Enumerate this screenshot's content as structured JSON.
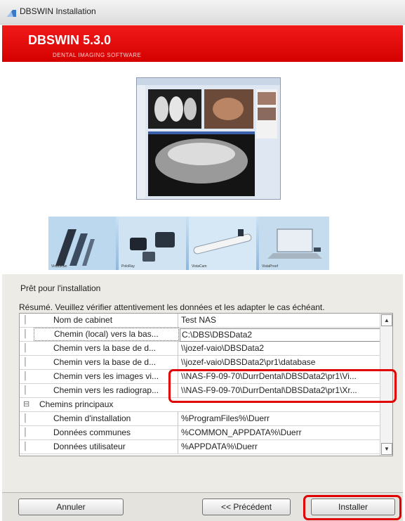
{
  "window": {
    "title": "DBSWIN Installation",
    "product": "DBSWIN 5.3.0",
    "subtitle": "DENTAL IMAGING SOFTWARE"
  },
  "products": [
    {
      "caption": "VistaScan"
    },
    {
      "caption": "PoloRay"
    },
    {
      "caption": "VistaCam"
    },
    {
      "caption": "VistaProof"
    }
  ],
  "ready_label": "Prêt pour l'installation",
  "summary_label": "Résumé. Veuillez vérifier attentivement les données et les adapter le cas échéant.",
  "rows": [
    {
      "label": "Nom de cabinet",
      "value": "Test NAS"
    },
    {
      "label": "Chemin (local) vers la bas...",
      "value": "C:\\DBS\\DBSData2"
    },
    {
      "label": "Chemin vers la base de d...",
      "value": "\\\\jozef-vaio\\DBSData2"
    },
    {
      "label": "Chemin vers la base de d...",
      "value": "\\\\jozef-vaio\\DBSData2\\pr1\\database"
    },
    {
      "label": "Chemin vers les images vi...",
      "value": "\\\\NAS-F9-09-70\\DurrDental\\DBSData2\\pr1\\Vi..."
    },
    {
      "label": "Chemin vers les radiograp...",
      "value": "\\\\NAS-F9-09-70\\DurrDental\\DBSData2\\pr1\\Xr..."
    },
    {
      "label": "Chemins principaux",
      "value": "",
      "expander": "⊟"
    },
    {
      "label": "Chemin d'installation",
      "value": "%ProgramFiles%\\Duerr"
    },
    {
      "label": "Données communes",
      "value": "%COMMON_APPDATA%\\Duerr"
    },
    {
      "label": "Données utilisateur",
      "value": "%APPDATA%\\Duerr"
    }
  ],
  "buttons": {
    "cancel": "Annuler",
    "back": "<< Précédent",
    "install": "Installer"
  },
  "colors": {
    "banner": "#e01010",
    "highlight": "#e00000"
  },
  "icons": {
    "app": "dbswin-app-icon",
    "scroll_up": "chevron-up-icon",
    "scroll_down": "chevron-down-icon",
    "collapse": "tree-collapse-icon"
  }
}
